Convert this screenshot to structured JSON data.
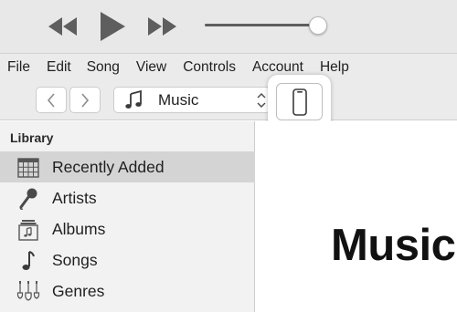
{
  "player": {
    "controls": [
      "rewind-icon",
      "play-icon",
      "fast-forward-icon"
    ],
    "volume_level": 0.95
  },
  "menu": {
    "items": [
      "File",
      "Edit",
      "Song",
      "View",
      "Controls",
      "Account",
      "Help"
    ]
  },
  "toolbar": {
    "back_icon": "chevron-left-icon",
    "forward_icon": "chevron-right-icon",
    "media_selector": {
      "icon": "music-note-icon",
      "selected": "Music"
    },
    "device_icon": "iphone-icon"
  },
  "sidebar": {
    "header": "Library",
    "items": [
      {
        "label": "Recently Added",
        "icon": "grid-icon",
        "selected": true
      },
      {
        "label": "Artists",
        "icon": "microphone-icon",
        "selected": false
      },
      {
        "label": "Albums",
        "icon": "album-icon",
        "selected": false
      },
      {
        "label": "Songs",
        "icon": "music-note-icon",
        "selected": false
      },
      {
        "label": "Genres",
        "icon": "guitar-icon",
        "selected": false
      }
    ]
  },
  "main": {
    "title": "Music"
  },
  "colors": {
    "player_bg": "#e8e8e8",
    "selected_row": "#d4d4d4",
    "icon_gray": "#5e5e5e"
  }
}
